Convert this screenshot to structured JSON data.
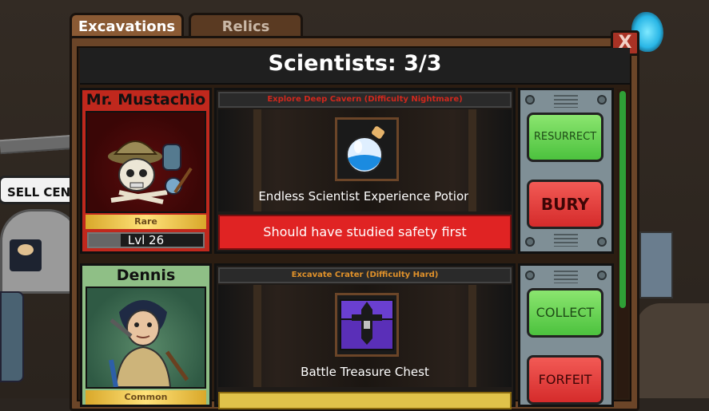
{
  "tabs": [
    {
      "label": "Excavations",
      "active": true
    },
    {
      "label": "Relics",
      "active": false
    }
  ],
  "close_label": "X",
  "header": {
    "title": "Scientists: 3/3"
  },
  "background": {
    "sell_sign": "SELL CENT"
  },
  "slots": [
    {
      "scientist": {
        "name": "Mr. Mustachio",
        "rarity": "Rare",
        "level": "Lvl 26",
        "header_color": "#c0281d",
        "portrait": "skull-explorer-portrait"
      },
      "expedition": {
        "title": "Explore Deep Cavern (Difficulty Nightmare)",
        "title_color": "#d0281d",
        "reward_item": "Endless Scientist Experience Potion",
        "reward_icon": "potion-icon",
        "status": "Should have studied safety first"
      },
      "actions": {
        "primary": {
          "label": "RESURRECT",
          "color": "green"
        },
        "secondary": {
          "label": "BURY",
          "color": "red"
        }
      }
    },
    {
      "scientist": {
        "name": "Dennis",
        "rarity": "Common",
        "level": "",
        "header_color": "#8fbf86",
        "portrait": "miner-portrait"
      },
      "expedition": {
        "title": "Excavate Crater (Difficulty Hard)",
        "title_color": "#e0912a",
        "reward_item": "Battle Treasure Chest",
        "reward_icon": "treasure-chest-icon",
        "status": ""
      },
      "actions": {
        "primary": {
          "label": "COLLECT",
          "color": "green"
        },
        "secondary": {
          "label": "FORFEIT",
          "color": "red"
        }
      }
    }
  ]
}
